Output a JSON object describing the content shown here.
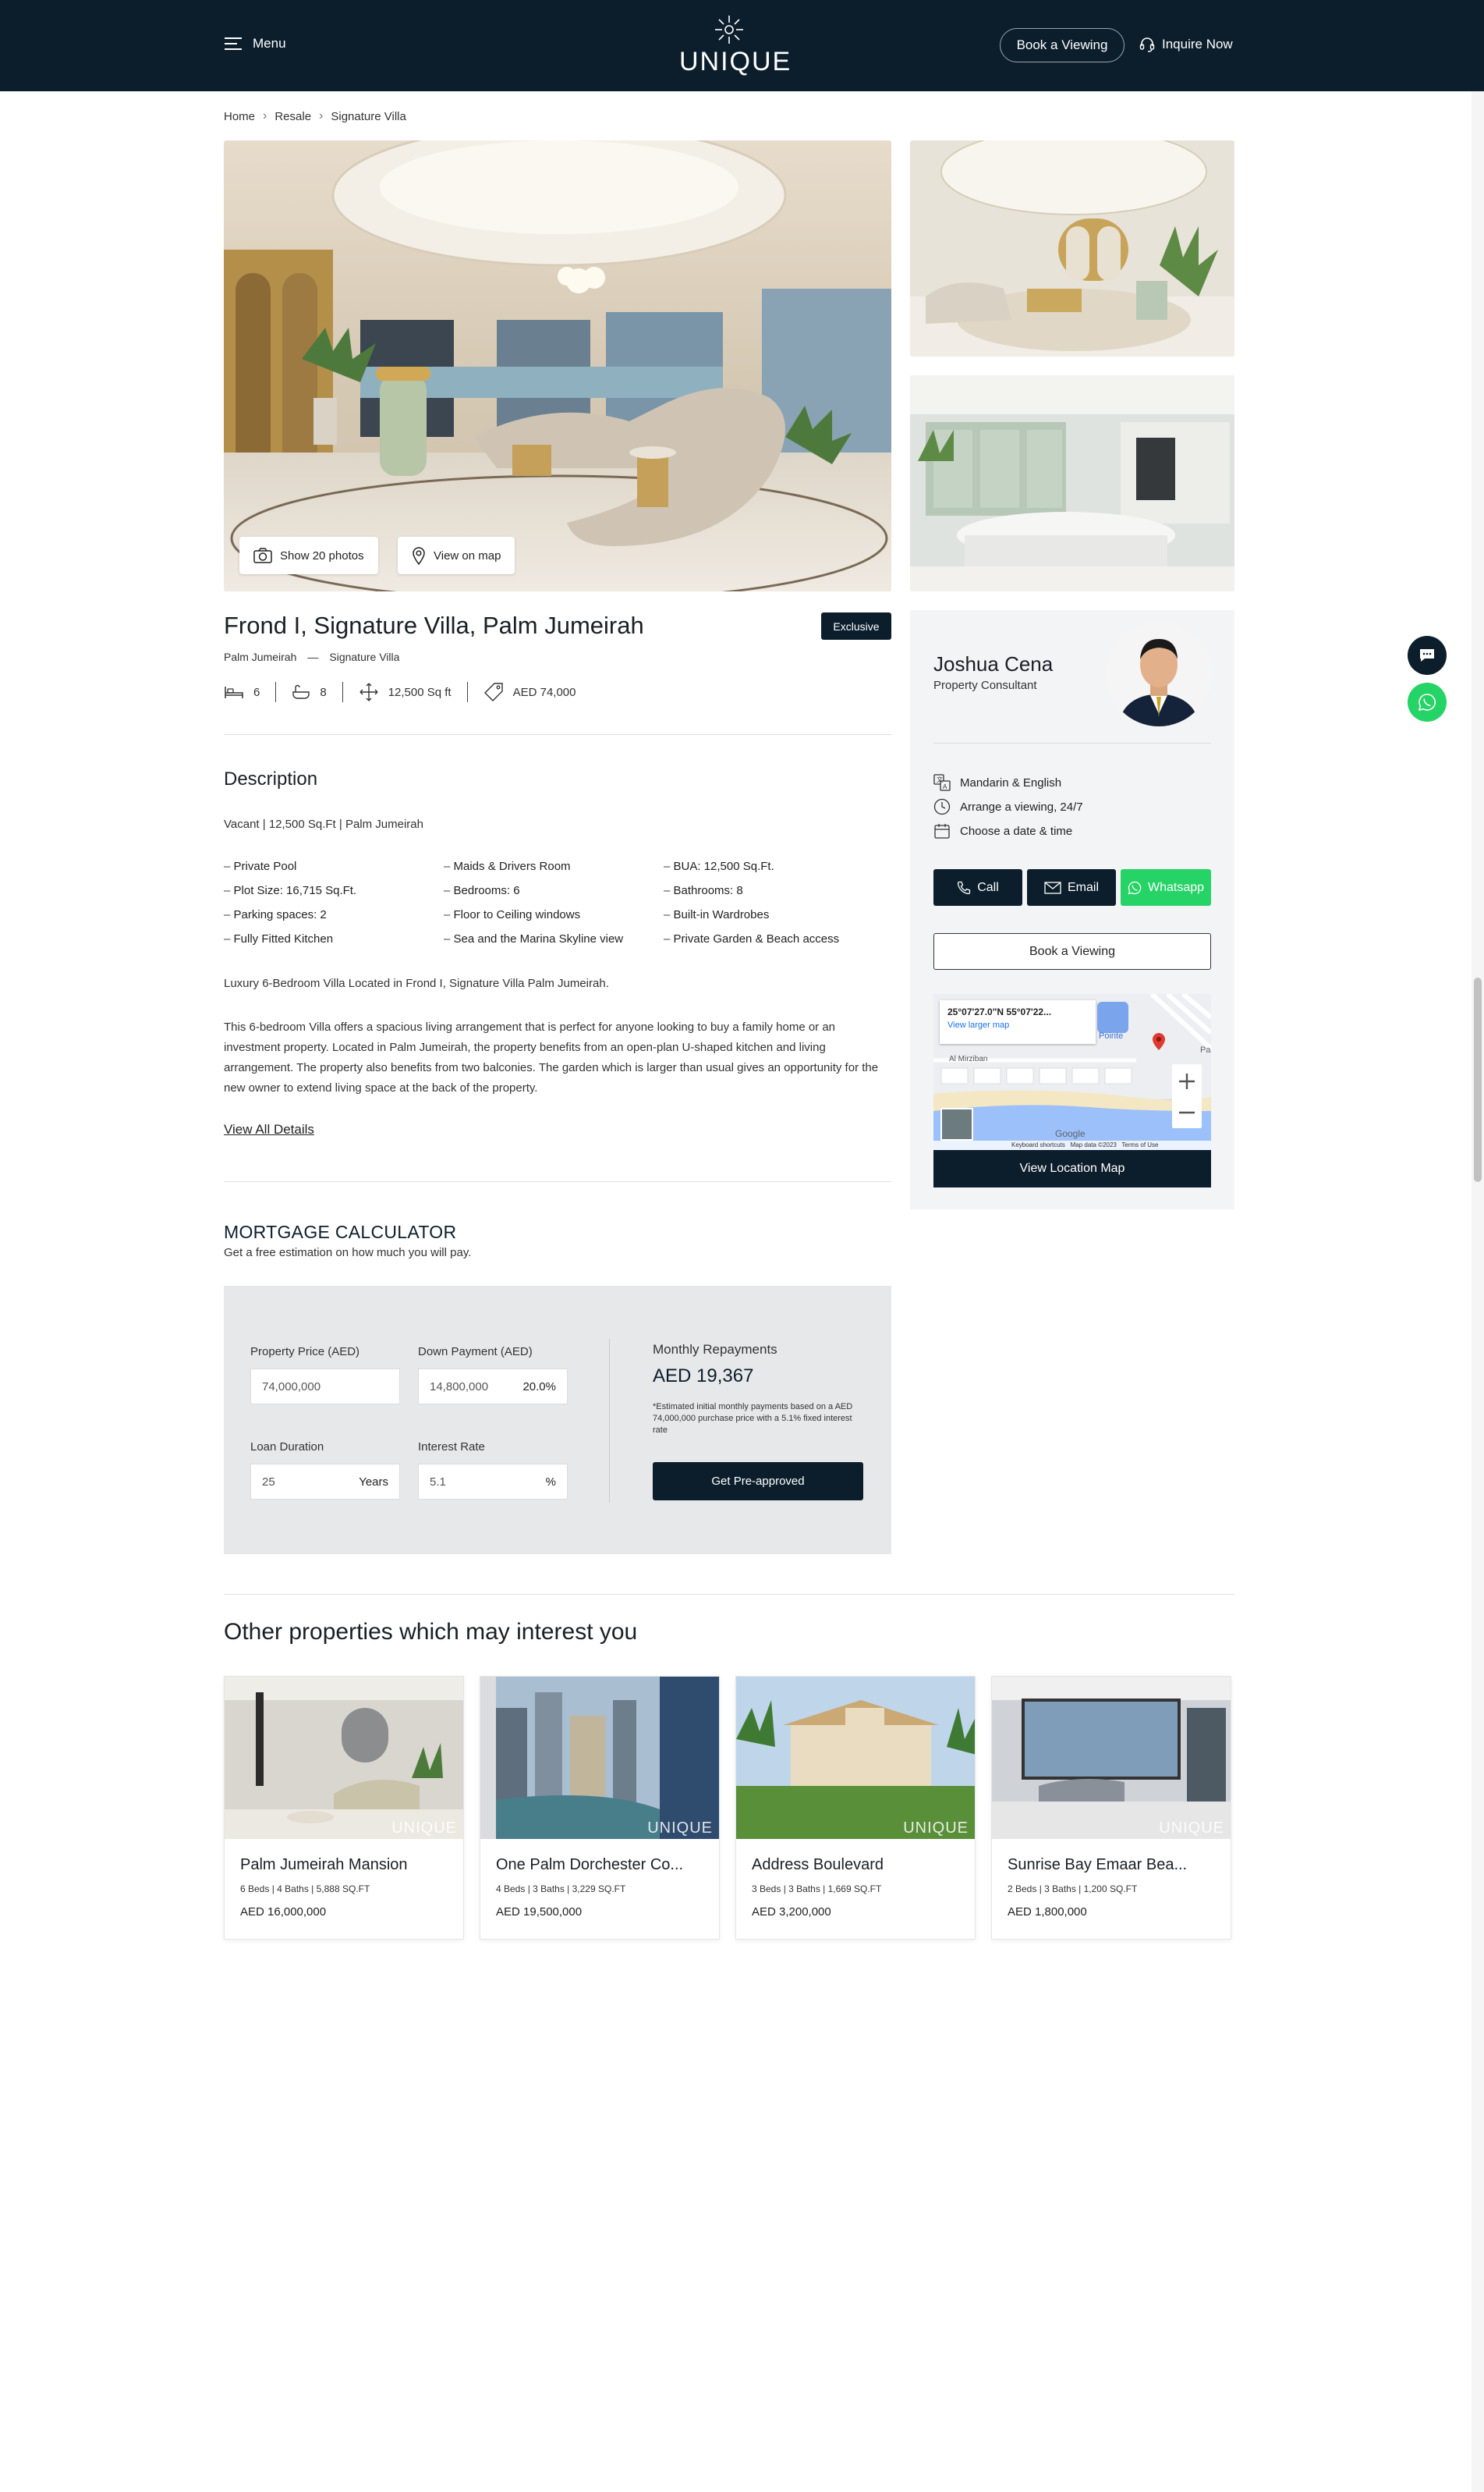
{
  "header": {
    "menu_label": "Menu",
    "logo_text": "UNIQUE",
    "book_label": "Book a Viewing",
    "inquire_label": "Inquire Now"
  },
  "breadcrumb": [
    "Home",
    "Resale",
    "Signature Villa"
  ],
  "gallery": {
    "show_photos_label": "Show 20 photos",
    "view_map_label": "View on map"
  },
  "property": {
    "title": "Frond I, Signature Villa, Palm Jumeirah",
    "badge": "Exclusive",
    "area": "Palm Jumeirah",
    "type": "Signature Villa",
    "beds": "6",
    "baths": "8",
    "size": "12,500 Sq ft",
    "price": "AED 74,000"
  },
  "description": {
    "heading": "Description",
    "summary": "Vacant | 12,500 Sq.Ft | Palm Jumeirah",
    "features": [
      "Private Pool",
      "Maids & Drivers Room",
      "BUA: 12,500 Sq.Ft.",
      "Plot Size: 16,715 Sq.Ft.",
      "Bedrooms: 6",
      "Bathrooms: 8",
      "Parking spaces: 2",
      "Floor to Ceiling windows",
      "Built-in Wardrobes",
      "Fully Fitted Kitchen",
      "Sea and the Marina Skyline view",
      "Private Garden & Beach access"
    ],
    "intro": "Luxury 6-Bedroom Villa Located in Frond I, Signature Villa Palm Jumeirah.",
    "body": "This 6-bedroom Villa offers a spacious living arrangement that is perfect for anyone looking to buy a family home or an investment property. Located in Palm Jumeirah, the property benefits from an open-plan U-shaped kitchen and living arrangement. The property also benefits from two balconies. The garden which is larger than usual gives an opportunity for the new owner to extend living space at the back of the property.",
    "view_all": "View All Details"
  },
  "mortgage": {
    "title": "MORTGAGE CALCULATOR",
    "subtitle": "Get a free estimation on how much you will pay.",
    "price_label": "Property Price (AED)",
    "price_value": "74,000,000",
    "down_label": "Down Payment (AED)",
    "down_value": "14,800,000",
    "down_pct": "20.0%",
    "duration_label": "Loan Duration",
    "duration_value": "25",
    "duration_suffix": "Years",
    "rate_label": "Interest Rate",
    "rate_value": "5.1",
    "rate_suffix": "%",
    "repay_label": "Monthly Repayments",
    "repay_value": "AED 19,367",
    "note": "*Estimated initial monthly payments based on a AED 74,000,000 purchase price with a 5.1% fixed interest rate",
    "cta": "Get Pre-approved"
  },
  "agent": {
    "name": "Joshua Cena",
    "role": "Property Consultant",
    "languages": "Mandarin & English",
    "availability": "Arrange a viewing, 24/7",
    "schedule": "Choose a date & time",
    "call": "Call",
    "email": "Email",
    "whatsapp": "Whatsapp",
    "book": "Book a Viewing",
    "map_coords": "25°07'27.0\"N 55°07'22...",
    "map_larger": "View larger map",
    "map_place": "Al Mirziban",
    "map_pointe": "Pointe",
    "map_pa": "Pa",
    "map_google": "Google",
    "map_footer": "Keyboard shortcuts   Map data ©2023   Terms of Use",
    "map_btn": "View Location Map"
  },
  "other": {
    "heading": "Other properties which may interest you",
    "cards": [
      {
        "title": "Palm Jumeirah Mansion",
        "meta": "6 Beds | 4 Baths | 5,888 SQ.FT",
        "price": "AED 16,000,000"
      },
      {
        "title": "One Palm Dorchester Co...",
        "meta": "4 Beds | 3 Baths | 3,229 SQ.FT",
        "price": "AED 19,500,000"
      },
      {
        "title": "Address Boulevard",
        "meta": "3 Beds | 3 Baths | 1,669 SQ.FT",
        "price": "AED 3,200,000"
      },
      {
        "title": "Sunrise Bay Emaar Bea...",
        "meta": "2 Beds | 3 Baths | 1,200 SQ.FT",
        "price": "AED 1,800,000"
      }
    ],
    "watermark": "UNIQUE"
  },
  "colors": {
    "navy": "#0c1e2c",
    "whatsapp": "#25d366",
    "card_bg": "#f3f4f6",
    "calc_bg": "#e7e8ea"
  }
}
